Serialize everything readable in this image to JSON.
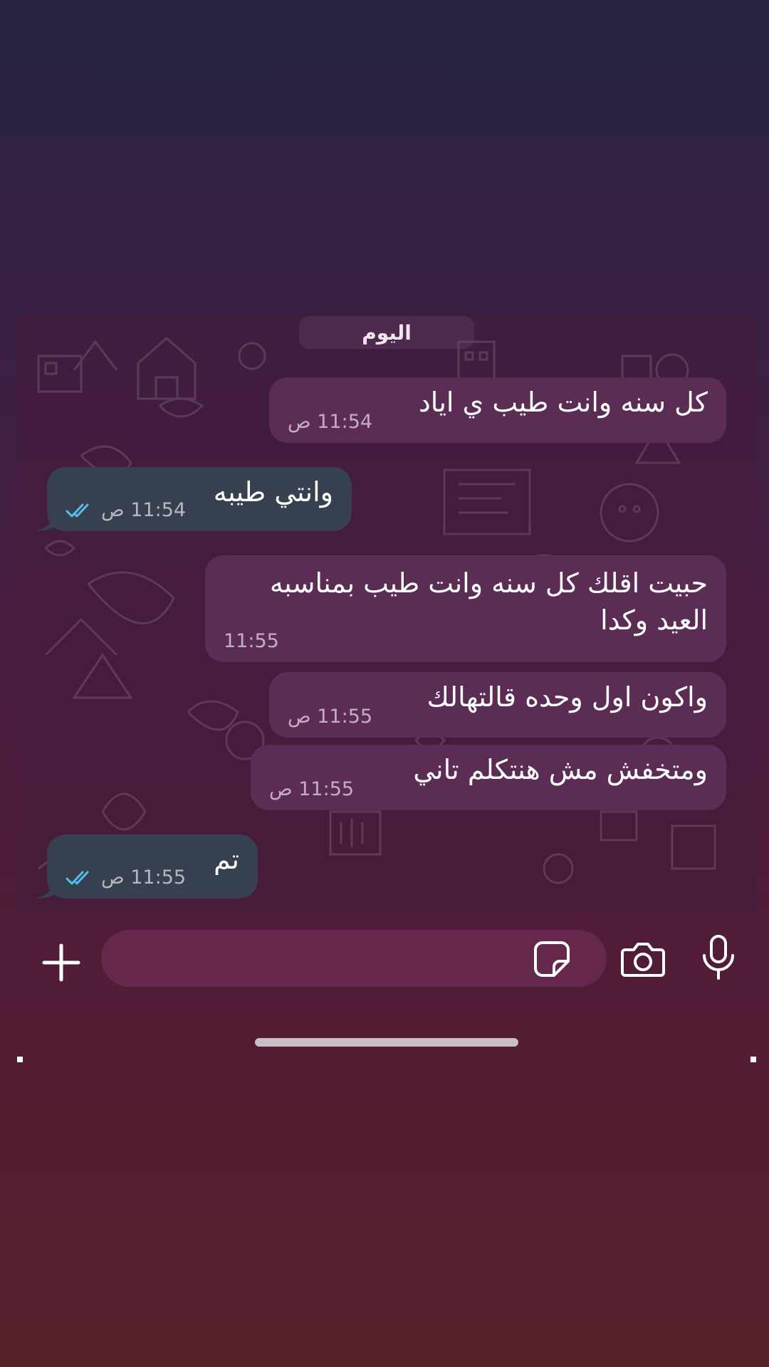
{
  "date_divider": "اليوم",
  "messages": [
    {
      "direction": "incoming",
      "text_lines": [
        "كل سنه وانت طيب ي اياد"
      ],
      "time": "11:54 ص"
    },
    {
      "direction": "outgoing",
      "text_lines": [
        "وانتي طيبه"
      ],
      "time": "11:54 ص",
      "status": "read"
    },
    {
      "direction": "incoming",
      "text_lines": [
        "حبيت اقلك كل سنه وانت طيب بمناسبه",
        "العيد وكدا"
      ],
      "time": "11:55"
    },
    {
      "direction": "incoming",
      "text_lines": [
        "واكون اول وحده قالتهالك"
      ],
      "time": "11:55 ص"
    },
    {
      "direction": "incoming",
      "text_lines": [
        "ومتخفش مش هنتكلم تاني"
      ],
      "time": "11:55 ص"
    },
    {
      "direction": "outgoing",
      "text_lines": [
        "تم"
      ],
      "time": "11:55 ص",
      "status": "read"
    }
  ],
  "composer": {
    "placeholder": "",
    "value": ""
  },
  "icons": {
    "attach": "plus-icon",
    "sticker": "sticker-icon",
    "camera": "camera-icon",
    "mic": "microphone-icon",
    "read_receipt": "double-check-icon"
  },
  "colors": {
    "incoming_bubble": "#5b2d55",
    "outgoing_bubble": "#36404f",
    "read_check": "#53bdeb"
  }
}
